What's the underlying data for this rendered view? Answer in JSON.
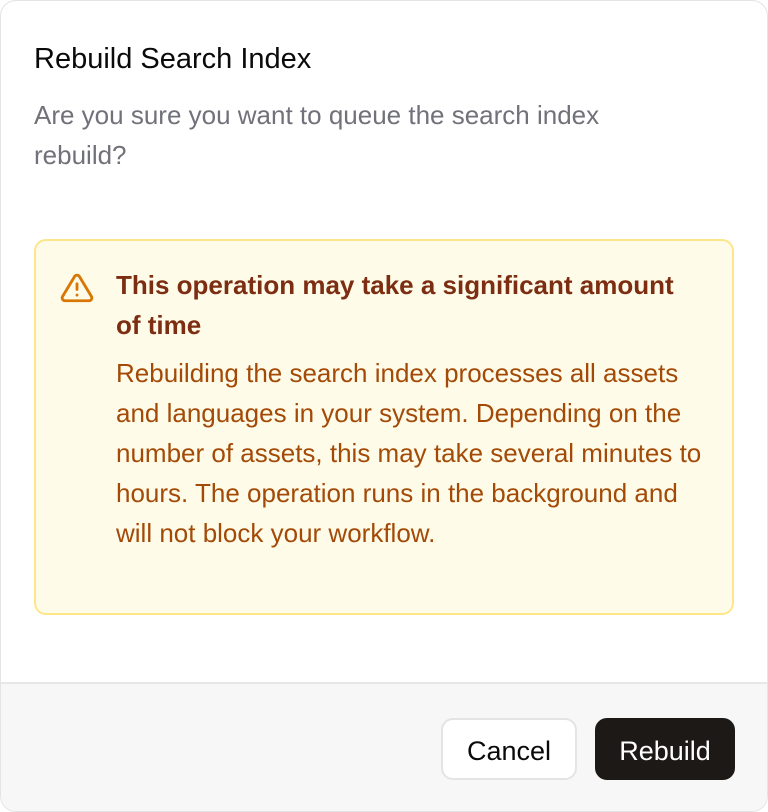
{
  "dialog": {
    "title": "Rebuild Search Index",
    "description": "Are you sure you want to queue the search index rebuild?",
    "alert": {
      "icon": "warning-triangle-icon",
      "title": "This operation may take a significant amount of time",
      "body": "Rebuilding the search index processes all assets and languages in your system. Depending on the number of assets, this may take several minutes to hours. The operation runs in the background and will not block your workflow."
    },
    "actions": {
      "cancel_label": "Cancel",
      "confirm_label": "Rebuild"
    }
  },
  "colors": {
    "alert_background": "#fefce8",
    "alert_border": "#fde68a",
    "alert_title": "#7c2d12",
    "alert_text": "#a34a08",
    "primary_button": "#1c1917"
  }
}
